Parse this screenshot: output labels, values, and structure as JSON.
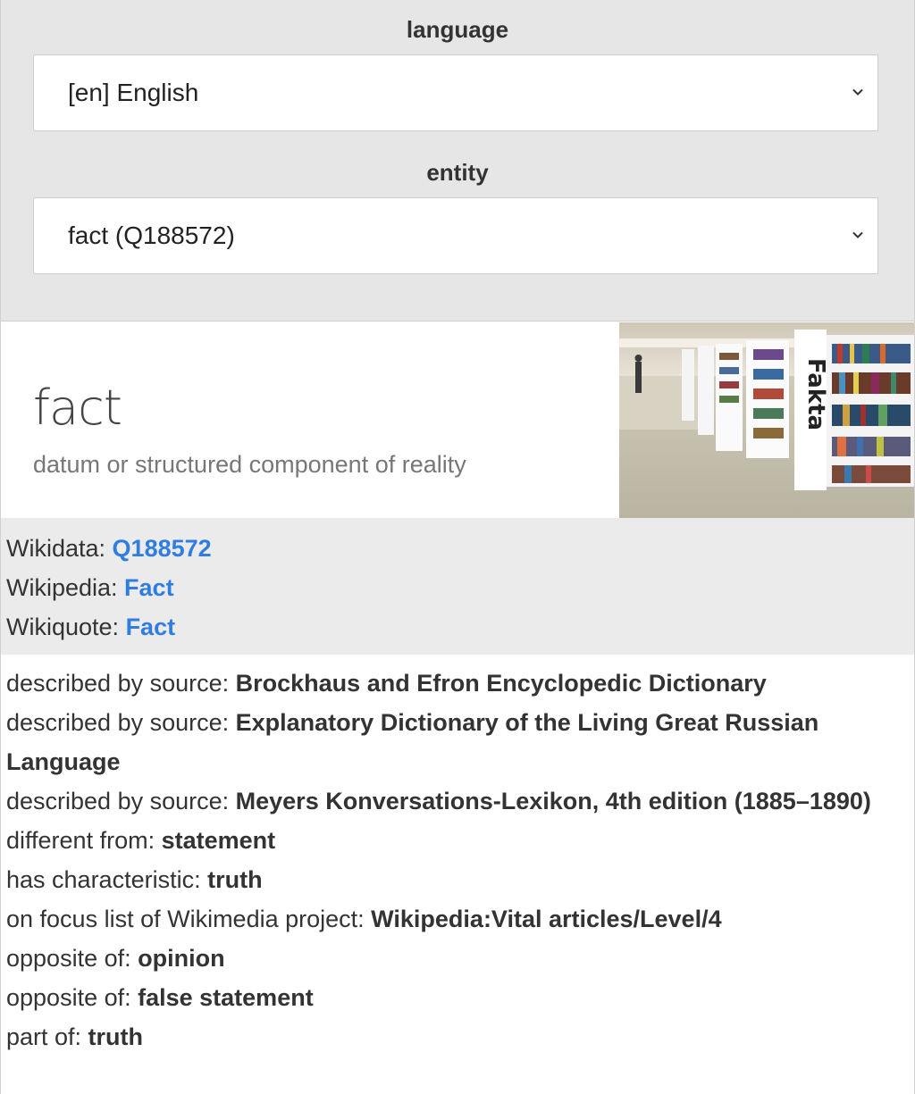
{
  "controls": {
    "language_label": "language",
    "language_value": "[en] English",
    "entity_label": "entity",
    "entity_value": "fact (Q188572)"
  },
  "entity": {
    "title": "fact",
    "description": "datum or structured component of reality"
  },
  "links": [
    {
      "prefix": "Wikidata: ",
      "text": "Q188572"
    },
    {
      "prefix": "Wikipedia: ",
      "text": "Fact"
    },
    {
      "prefix": "Wikiquote: ",
      "text": "Fact"
    }
  ],
  "claims": [
    {
      "property": "described by source: ",
      "value": "Brockhaus and Efron Encyclopedic Dictionary"
    },
    {
      "property": "described by source: ",
      "value": "Explanatory Dictionary of the Living Great Russian Language"
    },
    {
      "property": "described by source: ",
      "value": "Meyers Konversations-Lexikon, 4th edition (1885–1890)"
    },
    {
      "property": "different from: ",
      "value": "statement"
    },
    {
      "property": "has characteristic: ",
      "value": "truth"
    },
    {
      "property": "on focus list of Wikimedia project: ",
      "value": "Wikipedia:Vital articles/Level/4"
    },
    {
      "property": "opposite of: ",
      "value": "opinion"
    },
    {
      "property": "opposite of: ",
      "value": "false statement"
    },
    {
      "property": "part of: ",
      "value": "truth"
    }
  ],
  "colors": {
    "link": "#2f7de1",
    "controls_bg": "#e6e6e6",
    "links_bg": "#ebebeb"
  },
  "icons": {
    "dropdown": "chevron-down-icon"
  }
}
